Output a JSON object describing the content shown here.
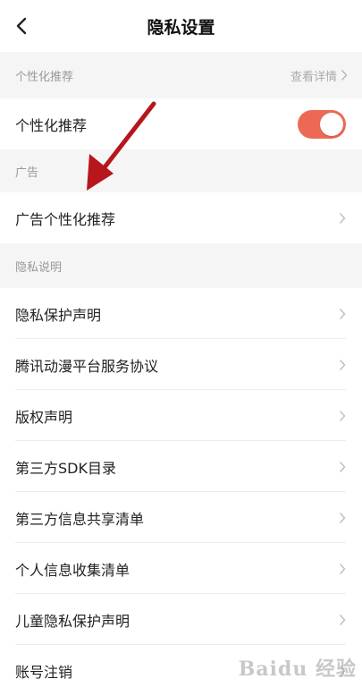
{
  "header": {
    "title": "隐私设置"
  },
  "personalization": {
    "section_label": "个性化推荐",
    "detail_link": "查看详情",
    "toggle_label": "个性化推荐",
    "toggle_on": true,
    "toggle_color": "#ec6a55"
  },
  "ads": {
    "section_label": "广告",
    "row_label": "广告个性化推荐"
  },
  "privacy": {
    "section_label": "隐私说明",
    "items": [
      {
        "label": "隐私保护声明"
      },
      {
        "label": "腾讯动漫平台服务协议"
      },
      {
        "label": "版权声明"
      },
      {
        "label": "第三方SDK目录"
      },
      {
        "label": "第三方信息共享清单"
      },
      {
        "label": "个人信息收集清单"
      },
      {
        "label": "儿童隐私保护声明"
      },
      {
        "label": "账号注销"
      }
    ]
  },
  "annotation": {
    "arrow_color": "#b5171c"
  },
  "watermark": {
    "text": "Baidu 经验"
  }
}
